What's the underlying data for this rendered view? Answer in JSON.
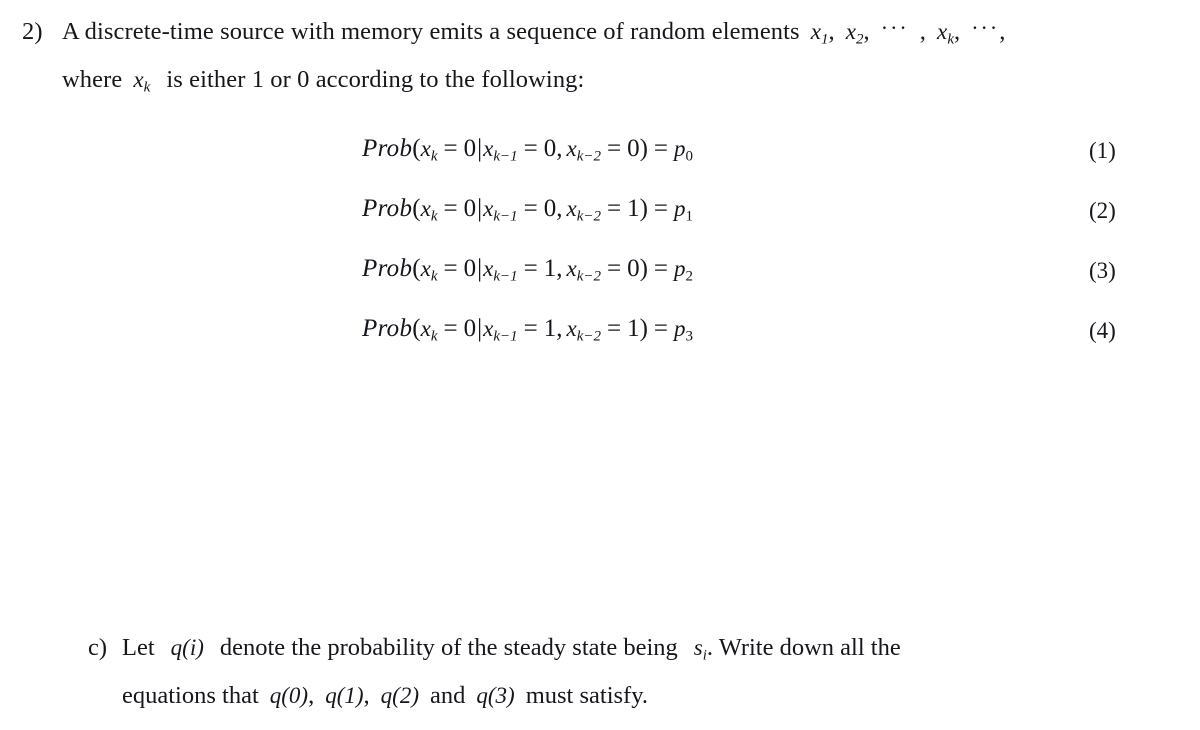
{
  "document": {
    "background_color": "#ffffff",
    "text_color": "#16161c"
  },
  "problem": {
    "number_label": "2)",
    "line1": {
      "text_before": "A discrete-time source with memory emits a sequence of random elements",
      "var": "x",
      "sub1": "1",
      "comma1": ",",
      "var2": "x",
      "sub2": "2",
      "comma2": ",",
      "dots1": "···",
      "comma3": ",",
      "var3": "x",
      "sub3": "k",
      "comma4": ",",
      "dots2": "···",
      "comma5": ","
    },
    "line2": {
      "text_before": "where",
      "var": "x",
      "sub": "k",
      "text_after": "is either 1 or 0 according to the following:"
    }
  },
  "equations": [
    {
      "id": "eq-1",
      "fn": "Prob",
      "open": "(",
      "lhs_var": "x",
      "lhs_sub": "k",
      "eq1": "=",
      "lhs_val": "0",
      "bar": "|",
      "c1_var": "x",
      "c1_sub": "k−1",
      "eq2": "=",
      "c1_val": "0",
      "comma": ",",
      "c2_var": "x",
      "c2_sub": "k−2",
      "eq3": "=",
      "c2_val": "0",
      "close": ")",
      "eq4": "=",
      "rhs_var": "p",
      "rhs_sub": "0",
      "number": "(1)"
    },
    {
      "id": "eq-2",
      "fn": "Prob",
      "open": "(",
      "lhs_var": "x",
      "lhs_sub": "k",
      "eq1": "=",
      "lhs_val": "0",
      "bar": "|",
      "c1_var": "x",
      "c1_sub": "k−1",
      "eq2": "=",
      "c1_val": "0",
      "comma": ",",
      "c2_var": "x",
      "c2_sub": "k−2",
      "eq3": "=",
      "c2_val": "1",
      "close": ")",
      "eq4": "=",
      "rhs_var": "p",
      "rhs_sub": "1",
      "number": "(2)"
    },
    {
      "id": "eq-3",
      "fn": "Prob",
      "open": "(",
      "lhs_var": "x",
      "lhs_sub": "k",
      "eq1": "=",
      "lhs_val": "0",
      "bar": "|",
      "c1_var": "x",
      "c1_sub": "k−1",
      "eq2": "=",
      "c1_val": "1",
      "comma": ",",
      "c2_var": "x",
      "c2_sub": "k−2",
      "eq3": "=",
      "c2_val": "0",
      "close": ")",
      "eq4": "=",
      "rhs_var": "p",
      "rhs_sub": "2",
      "number": "(3)"
    },
    {
      "id": "eq-4",
      "fn": "Prob",
      "open": "(",
      "lhs_var": "x",
      "lhs_sub": "k",
      "eq1": "=",
      "lhs_val": "0",
      "bar": "|",
      "c1_var": "x",
      "c1_sub": "k−1",
      "eq2": "=",
      "c1_val": "1",
      "comma": ",",
      "c2_var": "x",
      "c2_sub": "k−2",
      "eq3": "=",
      "c2_val": "1",
      "close": ")",
      "eq4": "=",
      "rhs_var": "p",
      "rhs_sub": "3",
      "number": "(4)"
    }
  ],
  "part_c": {
    "label": "c)",
    "line1": {
      "t1": "Let",
      "q1": "q",
      "q1_arg": "(i)",
      "t2": "denote  the  probability  of  the  steady  state  being",
      "s": "s",
      "s_sub": "i",
      "t3": ".  Write  down  all  the"
    },
    "line2": {
      "t1": "equations that",
      "q0": "q",
      "q0_arg": "(0)",
      "c0": ",",
      "q1": "q",
      "q1_arg": "(1)",
      "c1": ",",
      "q2": "q",
      "q2_arg": "(2)",
      "t2": "and",
      "q3": "q",
      "q3_arg": "(3)",
      "t3": "must satisfy."
    }
  }
}
